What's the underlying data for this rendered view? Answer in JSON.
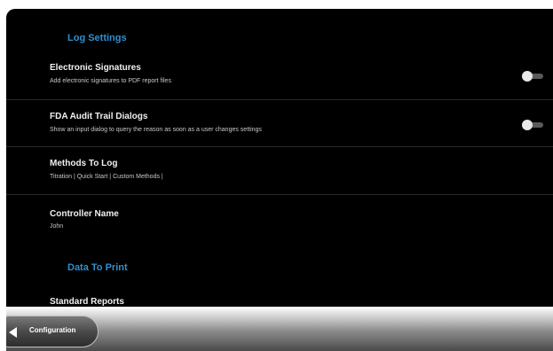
{
  "sections": {
    "log_settings_title": "Log Settings",
    "data_to_print_title": "Data To Print"
  },
  "settings": [
    {
      "title": "Electronic Signatures",
      "subtitle": "Add electronic signatures to PDF report files",
      "toggle_state": "off"
    },
    {
      "title": "FDA Audit Trail Dialogs",
      "subtitle": "Show an input dialog to query the reason as soon as a user changes settings",
      "toggle_state": "off"
    },
    {
      "title": "Methods To Log",
      "subtitle": "Titration | Quick Start | Custom Methods |"
    },
    {
      "title": "Controller Name",
      "subtitle": "John"
    }
  ],
  "data_to_print": {
    "standard_reports_label": "Standard Reports"
  },
  "navigation": {
    "back_label": "Configuration"
  }
}
